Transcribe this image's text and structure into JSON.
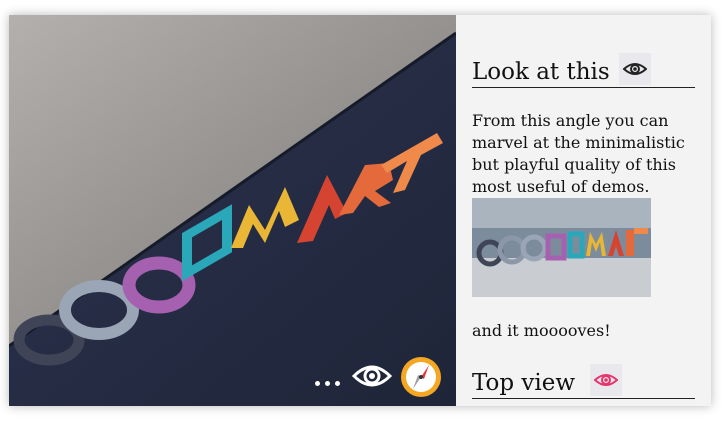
{
  "scene": {
    "logo_text": "CODEMART",
    "logo_colors": [
      "#3f4556",
      "#7d8596",
      "#a8b5c4",
      "#8f3f86",
      "#b86fc2",
      "#2aa8b9",
      "#e9b635",
      "#d44431",
      "#e56a3b",
      "#ef8a4a"
    ],
    "table_color": "#252c42",
    "wall_color": "#8f8c8a"
  },
  "controls": {
    "more_icon": "more-dots-icon",
    "view_icon": "eye-icon",
    "navigation_icon": "compass-icon",
    "compass_ring_color": "#f5a623"
  },
  "sidebar": {
    "section1": {
      "title": "Look at this",
      "icon": "eye-icon",
      "icon_color": "#222222",
      "paragraph": "From this angle you can marvel at the minimalistic but playful quality of this most useful of demos.",
      "image_alt": "CODEMART logo thumbnail",
      "after_text": "and it mooooves!"
    },
    "section2": {
      "title": "Top view",
      "icon": "eye-icon",
      "icon_color": "#e8336b"
    }
  }
}
